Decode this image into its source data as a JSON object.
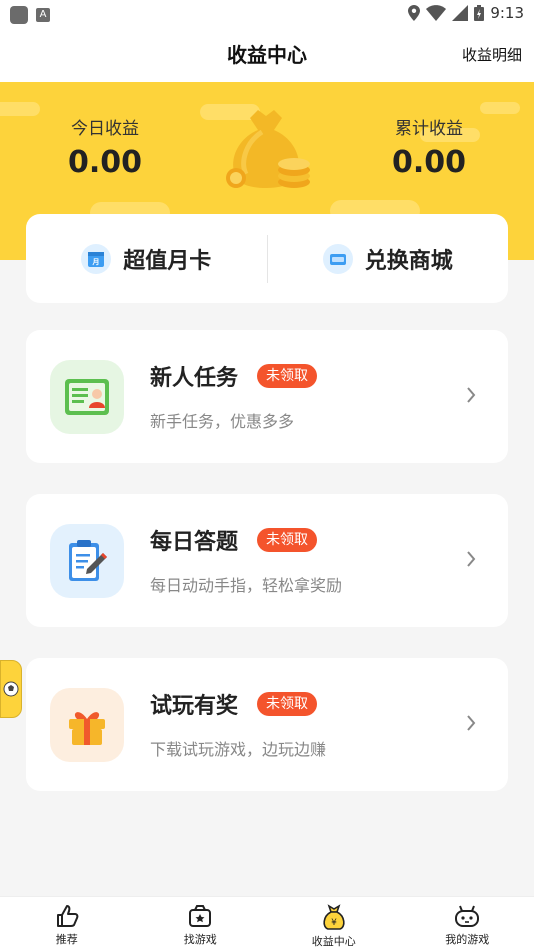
{
  "status_bar": {
    "time": "9:13"
  },
  "header": {
    "title": "收益中心",
    "detail_link": "收益明细"
  },
  "earnings": {
    "today_label": "今日收益",
    "today_value": "0.00",
    "total_label": "累计收益",
    "total_value": "0.00"
  },
  "quick_actions": [
    {
      "label": "超值月卡",
      "icon": "calendar-icon"
    },
    {
      "label": "兑换商城",
      "icon": "store-icon"
    }
  ],
  "tasks": [
    {
      "title": "新人任务",
      "badge": "未领取",
      "desc": "新手任务，优惠多多",
      "icon": "id-card-icon"
    },
    {
      "title": "每日答题",
      "badge": "未领取",
      "desc": "每日动动手指，轻松拿奖励",
      "icon": "clipboard-icon"
    },
    {
      "title": "试玩有奖",
      "badge": "未领取",
      "desc": "下载试玩游戏，边玩边赚",
      "icon": "gift-icon"
    }
  ],
  "tabbar": [
    {
      "label": "推荐",
      "icon": "like-icon"
    },
    {
      "label": "找游戏",
      "icon": "game-box-icon"
    },
    {
      "label": "收益中心",
      "icon": "money-bag-icon",
      "active": true
    },
    {
      "label": "我的游戏",
      "icon": "robot-icon"
    }
  ],
  "colors": {
    "accent": "#fdd33b",
    "badge": "#f4542c"
  }
}
